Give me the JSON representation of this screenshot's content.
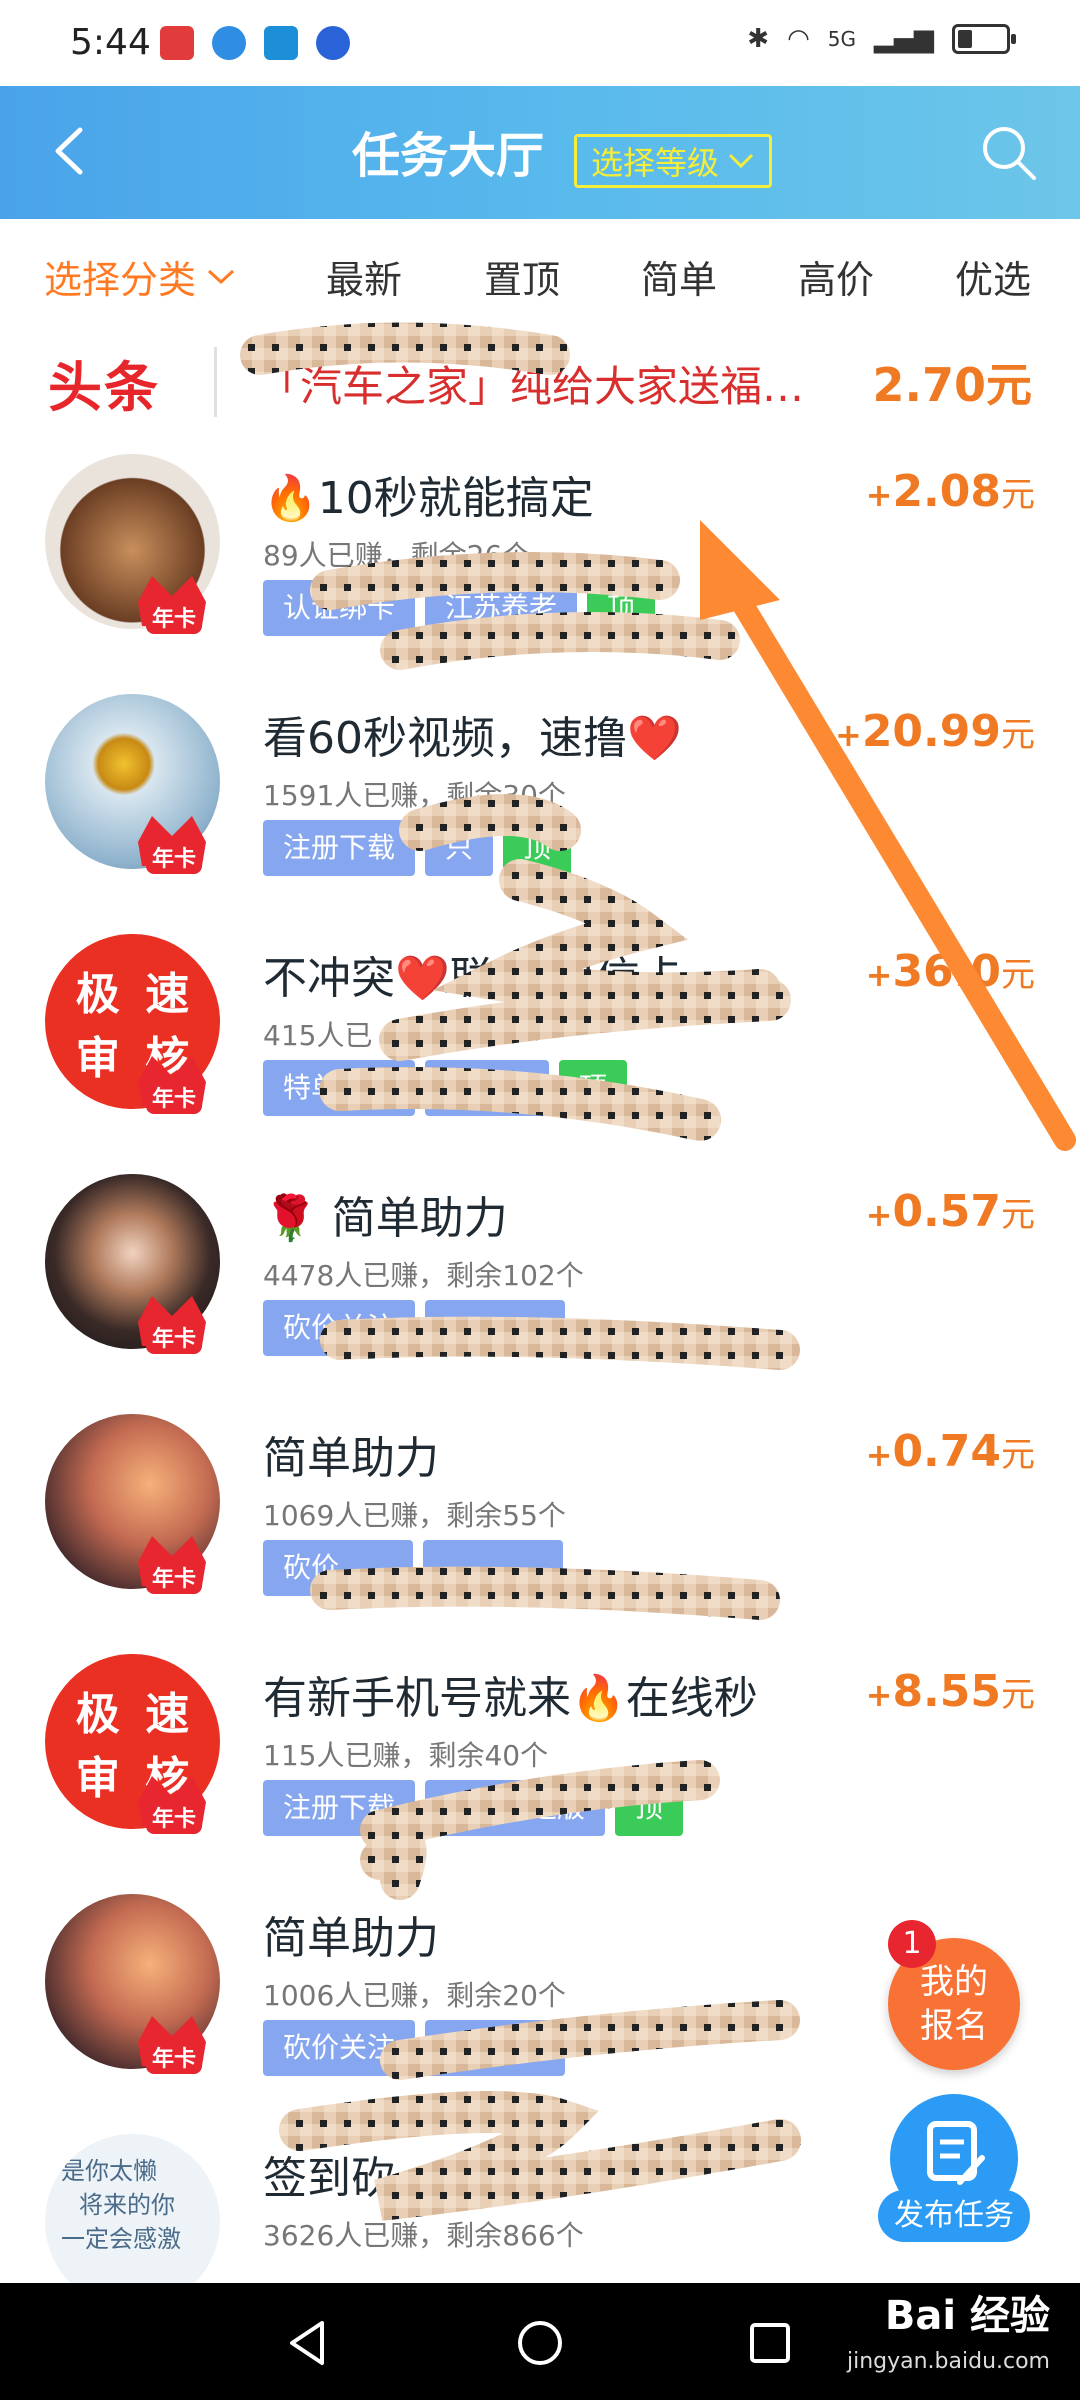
{
  "status_bar": {
    "time": "5:44",
    "network": "5G",
    "battery_level": 0.3
  },
  "header": {
    "title": "任务大厅",
    "level_select": "选择等级"
  },
  "tabs": {
    "category": "选择分类",
    "items": [
      "最新",
      "置顶",
      "简单",
      "高价",
      "优选"
    ]
  },
  "headline": {
    "logo": "头条",
    "text": "「汽车之家」纯给大家送福…",
    "price": "2.70元"
  },
  "tasks": [
    {
      "title": "🔥10秒就能搞定",
      "meta": "89人已赚，剩余26个",
      "tags": [
        "认证绑卡",
        "江苏养老",
        "顶"
      ],
      "price_plus": "+",
      "price": "2.08",
      "unit": "元",
      "badge": "年卡"
    },
    {
      "title": "看60秒视频，速撸❤️",
      "meta": "1591人已赚，剩余30个",
      "tags": [
        "注册下载",
        "只",
        "顶"
      ],
      "price_plus": "+",
      "price": "20.99",
      "unit": "元",
      "badge": "年卡"
    },
    {
      "title": "不冲突❤️联通 电信卡",
      "meta": "415人已",
      "tags": [
        "特单任务",
        "移动卡",
        "顶"
      ],
      "price_plus": "+",
      "price": "36.0",
      "unit": "元",
      "badge": "年卡",
      "avatar_text": [
        "极",
        "速",
        "审",
        "核"
      ]
    },
    {
      "title": "🌹 简单助力",
      "meta": "4478人已赚，剩余102个",
      "tags": [
        "砍价关注",
        "",
        ""
      ],
      "price_plus": "+",
      "price": "0.57",
      "unit": "元",
      "badge": "年卡"
    },
    {
      "title": "简单助力",
      "meta": "1069人已赚，剩余55个",
      "tags": [
        "砍价",
        "",
        ""
      ],
      "price_plus": "+",
      "price": "0.74",
      "unit": "元",
      "badge": "年卡"
    },
    {
      "title": "有新手机号就来🔥在线秒",
      "meta": "115人已赚，剩余40个",
      "tags": [
        "注册下载",
        "京东极速版",
        "顶"
      ],
      "price_plus": "+",
      "price": "8.55",
      "unit": "元",
      "badge": "年卡",
      "avatar_text": [
        "极",
        "速",
        "审",
        "核"
      ]
    },
    {
      "title": "简单助力",
      "meta": "1006人已赚，剩余20个",
      "tags": [
        "砍价关注",
        "",
        ""
      ],
      "price_plus": "",
      "price": "",
      "unit": "元",
      "badge": "年卡"
    },
    {
      "title": "签到砍一刀",
      "meta": "3626人已赚，剩余866个",
      "tags": [],
      "price_plus": "",
      "price": "",
      "unit": "元",
      "badge": "",
      "avatar_caption": [
        "是你太懒",
        "将来的你",
        "一定会感激"
      ]
    }
  ],
  "fab": {
    "signup_line1": "我的",
    "signup_line2": "报名",
    "signup_badge": "1",
    "publish": "发布任务"
  },
  "watermark": {
    "brand": "Bai 经验",
    "url": "jingyan.baidu.com"
  },
  "colors": {
    "header_start": "#4aa3ea",
    "accent_orange": "#f07a23",
    "headline_red": "#d92e2e",
    "tag_blue": "#86a7ef",
    "tag_green": "#3bcb58",
    "level_yellow": "#f5ee39"
  }
}
